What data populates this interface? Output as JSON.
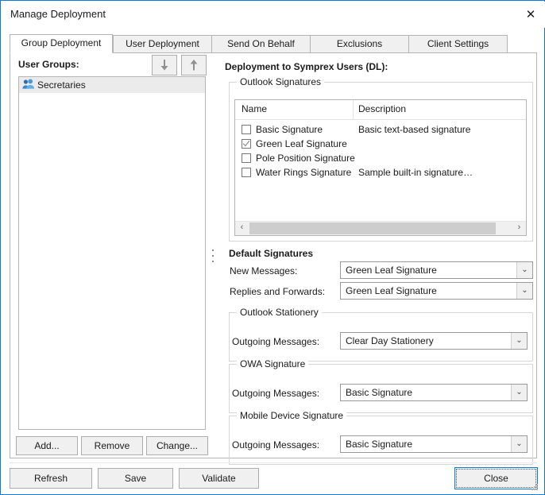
{
  "window": {
    "title": "Manage Deployment",
    "close_icon": "close-icon",
    "close_glyph": "✕"
  },
  "tabs": [
    {
      "label": "Group Deployment",
      "selected": true
    },
    {
      "label": "User Deployment",
      "selected": false
    },
    {
      "label": "Send On Behalf",
      "selected": false
    },
    {
      "label": "Exclusions",
      "selected": false
    },
    {
      "label": "Client Settings",
      "selected": false
    }
  ],
  "left_panel": {
    "label": "User Groups:",
    "move_down_icon": "arrow-down-icon",
    "move_up_icon": "arrow-up-icon",
    "groups": [
      {
        "name": "Secretaries",
        "icon": "user-group-icon",
        "selected": true
      }
    ],
    "buttons": {
      "add": "Add...",
      "remove": "Remove",
      "change": "Change..."
    }
  },
  "right_panel": {
    "heading": "Deployment to Symprex Users (DL):",
    "outlook_signatures": {
      "group_title": "Outlook Signatures",
      "columns": [
        "Name",
        "Description"
      ],
      "rows": [
        {
          "name": "Basic Signature",
          "description": "Basic text-based signature",
          "checked": false
        },
        {
          "name": "Green Leaf Signature",
          "description": "",
          "checked": true
        },
        {
          "name": "Pole Position Signature",
          "description": "",
          "checked": false
        },
        {
          "name": "Water Rings Signature",
          "description": "Sample built-in signature…",
          "checked": false
        }
      ],
      "scrollbar": {
        "left_glyph": "‹",
        "right_glyph": "›"
      }
    },
    "default_signatures": {
      "title": "Default Signatures",
      "fields": [
        {
          "label": "New Messages:",
          "value": "Green Leaf Signature"
        },
        {
          "label": "Replies and Forwards:",
          "value": "Green Leaf Signature"
        }
      ]
    },
    "outlook_stationery": {
      "group_title": "Outlook Stationery",
      "field": {
        "label": "Outgoing Messages:",
        "value": "Clear Day Stationery"
      }
    },
    "owa_signature": {
      "group_title": "OWA Signature",
      "field": {
        "label": "Outgoing Messages:",
        "value": "Basic Signature"
      }
    },
    "mobile_device_signature": {
      "group_title": "Mobile Device Signature",
      "field": {
        "label": "Outgoing Messages:",
        "value": "Basic Signature"
      }
    }
  },
  "action_bar": {
    "refresh": "Refresh",
    "save": "Save",
    "validate": "Validate",
    "close": "Close"
  },
  "colors": {
    "window_border": "#0a7cd4",
    "focus_border": "#0a7cd4",
    "group_icon": "#3a7fbf",
    "selection": "#ebebeb",
    "button_face": "#f0f0f0"
  },
  "combo_arrow_glyph": "⌄"
}
